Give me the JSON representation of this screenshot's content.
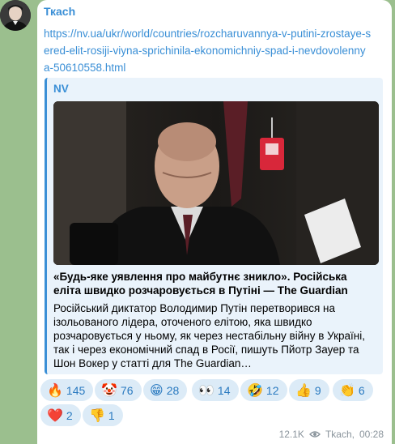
{
  "post": {
    "sender": "Ткасh",
    "link": "https://nv.ua/ukr/world/countries/rozcharuvannya-v-putini-zrostaye-sered-elit-rosiji-viyna-sprichinila-ekonomichniy-spad-i-nevdovolennya-50610558.html",
    "preview": {
      "site": "NV",
      "title": "«Будь-яке уявлення про майбутнє зникло». Російська еліта швидко розчаровується в Путіні — The Guardian",
      "description": "Російський диктатор Володимир Путін перетворився на ізольованого лідера, оточеного елітою, яка швидко розчаровується у ньому, як через нестабільну війну в Україні, так і через економічний спад в Росії, пишуть Пйотр Зауер та Шон Вокер у статті для The Guardian…"
    },
    "reactions": [
      {
        "emoji": "🔥",
        "icon": "fire-icon",
        "count": "145"
      },
      {
        "emoji": "🤡",
        "icon": "clown-icon",
        "count": "76"
      },
      {
        "emoji": "😁",
        "icon": "grin-icon",
        "count": "28"
      },
      {
        "emoji": "👀",
        "icon": "eyes-icon",
        "count": "14"
      },
      {
        "emoji": "🤣",
        "icon": "rofl-icon",
        "count": "12"
      },
      {
        "emoji": "👍",
        "icon": "thumbs-up-icon",
        "count": "9"
      },
      {
        "emoji": "👏",
        "icon": "clap-icon",
        "count": "6"
      },
      {
        "emoji": "❤️",
        "icon": "heart-icon",
        "count": "2"
      },
      {
        "emoji": "👎",
        "icon": "thumbs-down-icon",
        "count": "1"
      }
    ],
    "views": "12.1K",
    "author": "Tkach",
    "time": "00:28"
  },
  "colors": {
    "background": "#9bbf8e",
    "accent": "#3a8fd6",
    "reaction_bg": "#dcebf7"
  }
}
